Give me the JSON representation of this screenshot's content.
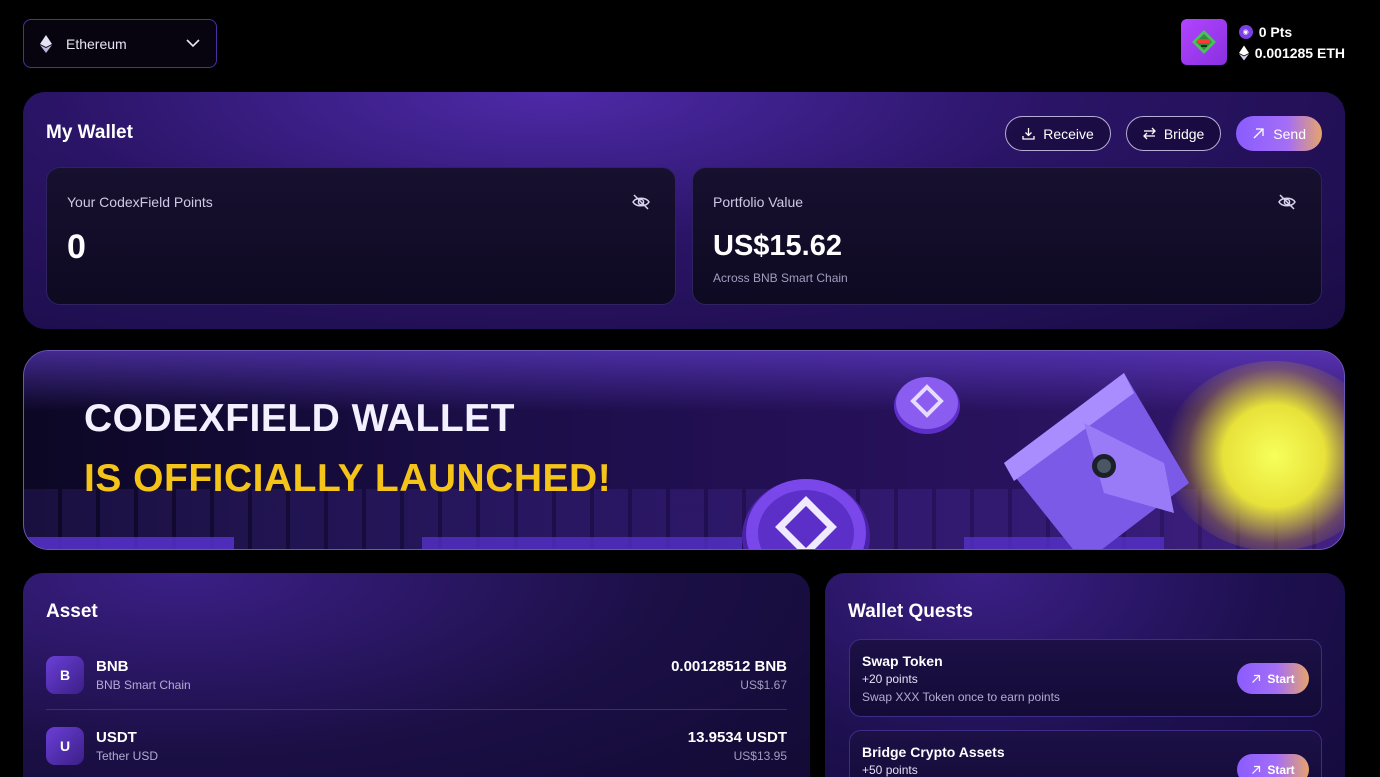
{
  "header": {
    "network": {
      "label": "Ethereum",
      "icon": "ethereum-icon"
    },
    "points": "0 Pts",
    "eth_balance": "0.001285 ETH"
  },
  "wallet": {
    "title": "My Wallet",
    "actions": {
      "receive": "Receive",
      "bridge": "Bridge",
      "send": "Send"
    },
    "points_card": {
      "label": "Your CodexField Points",
      "value": "0"
    },
    "portfolio_card": {
      "label": "Portfolio Value",
      "value": "US$15.62",
      "sub": "Across BNB Smart Chain"
    }
  },
  "banner": {
    "line1": "CODEXFIELD WALLET",
    "line2": "IS OFFICIALLY LAUNCHED!"
  },
  "assets": {
    "title": "Asset",
    "items": [
      {
        "badge": "B",
        "symbol": "BNB",
        "chain": "BNB Smart Chain",
        "amount": "0.00128512 BNB",
        "usd": "US$1.67"
      },
      {
        "badge": "U",
        "symbol": "USDT",
        "chain": "Tether USD",
        "amount": "13.9534 USDT",
        "usd": "US$13.95"
      }
    ]
  },
  "quests": {
    "title": "Wallet Quests",
    "items": [
      {
        "name": "Swap Token",
        "points": "+20 points",
        "desc": "Swap XXX Token once to earn points",
        "action": "Start"
      },
      {
        "name": "Bridge Crypto Assets",
        "points": "+50 points",
        "desc": "",
        "action": "Start"
      }
    ]
  },
  "colors": {
    "accent_purple": "#8a5cff",
    "banner_yellow": "#f5c418",
    "send_gradient_end": "#e6a46c"
  }
}
